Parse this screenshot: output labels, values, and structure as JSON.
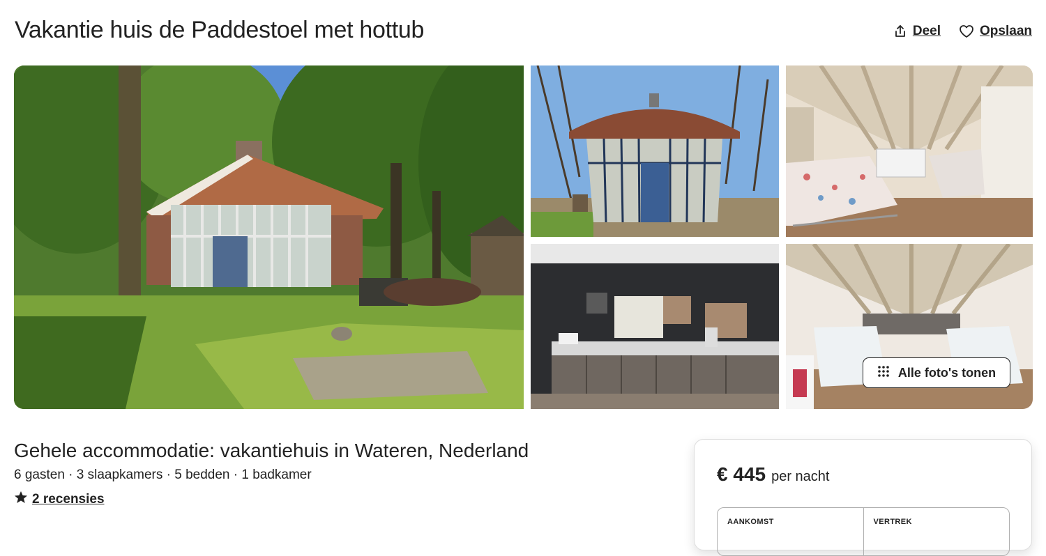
{
  "listing": {
    "title": "Vakantie huis de Paddestoel met hottub",
    "subtitle": "Gehele accommodatie: vakantiehuis in Wateren, Nederland",
    "facts": "6 gasten · 3 slaapkamers · 5 bedden · 1 badkamer",
    "reviews_label": "2 recensies"
  },
  "actions": {
    "share_label": "Deel",
    "save_label": "Opslaan"
  },
  "gallery": {
    "show_all_label": "Alle foto's tonen"
  },
  "booking": {
    "price": "€ 445",
    "per_night": "per nacht",
    "checkin_label": "AANKOMST",
    "checkout_label": "VERTREK"
  },
  "icons": {
    "share": "share-icon",
    "save": "heart-icon",
    "grid": "grid-dots-icon",
    "star": "star-icon"
  },
  "colors": {
    "text": "#222222",
    "border": "#dddddd"
  }
}
